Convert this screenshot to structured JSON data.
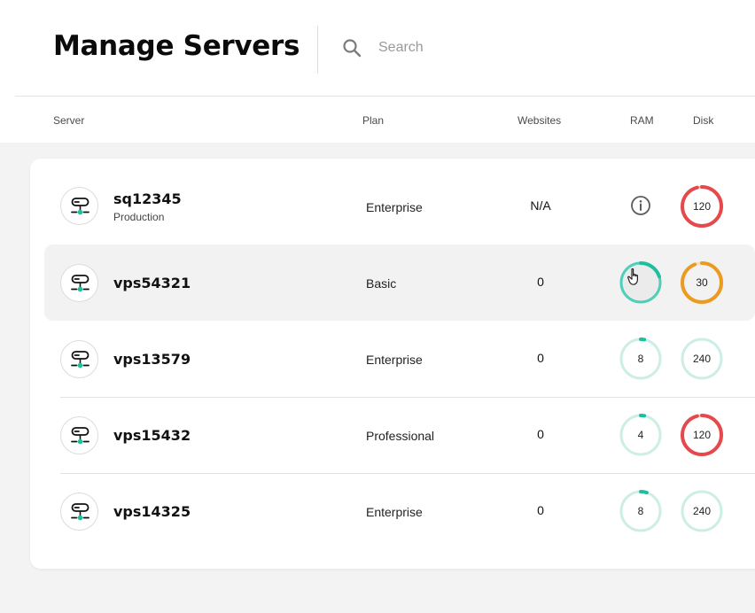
{
  "header": {
    "title": "Manage Servers",
    "search_placeholder": "Search"
  },
  "columns": {
    "server": "Server",
    "plan": "Plan",
    "websites": "Websites",
    "ram": "RAM",
    "disk": "Disk"
  },
  "colors": {
    "ram_ok": "#4fcfb8",
    "ram_track": "#cdeee6",
    "disk_critical": "#e5494c",
    "disk_warning": "#eb9a22",
    "disk_ok_track": "#cdeee6",
    "accent_teal": "#1cbf9e"
  },
  "servers": [
    {
      "name": "sq12345",
      "sub": "Production",
      "plan": "Enterprise",
      "websites": "N/A",
      "ram": {
        "icon": "info-icon"
      },
      "disk": {
        "value": "120",
        "status": "critical",
        "fraction": 0.96
      }
    },
    {
      "name": "vps54321",
      "sub": "",
      "plan": "Basic",
      "websites": "0",
      "ram": {
        "value": "",
        "status": "ok",
        "fraction": 0.2,
        "hovered": true,
        "icon": "hand-pointer-icon"
      },
      "disk": {
        "value": "30",
        "status": "warning",
        "fraction": 0.94
      }
    },
    {
      "name": "vps13579",
      "sub": "",
      "plan": "Enterprise",
      "websites": "0",
      "ram": {
        "value": "8",
        "status": "ok",
        "fraction": 0.03
      },
      "disk": {
        "value": "240",
        "status": "ok",
        "fraction": 0.0
      }
    },
    {
      "name": "vps15432",
      "sub": "",
      "plan": "Professional",
      "websites": "0",
      "ram": {
        "value": "4",
        "status": "ok",
        "fraction": 0.03
      },
      "disk": {
        "value": "120",
        "status": "critical",
        "fraction": 0.96
      }
    },
    {
      "name": "vps14325",
      "sub": "",
      "plan": "Enterprise",
      "websites": "0",
      "ram": {
        "value": "8",
        "status": "ok",
        "fraction": 0.05
      },
      "disk": {
        "value": "240",
        "status": "ok",
        "fraction": 0.0
      }
    }
  ]
}
